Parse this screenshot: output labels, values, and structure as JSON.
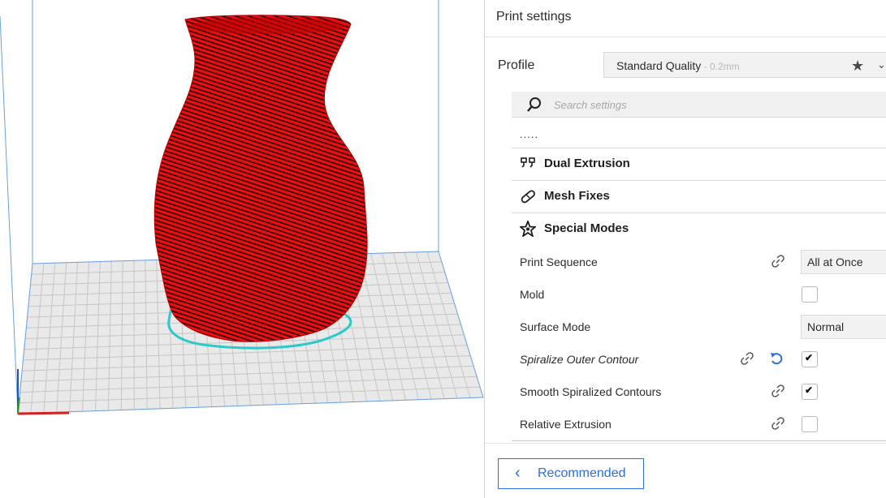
{
  "panel": {
    "title": "Print settings",
    "profile_label": "Profile",
    "profile_name": "Standard Quality",
    "profile_sub": " - 0.2mm",
    "search_placeholder": "Search settings",
    "collapsed_indicator": ".....",
    "categories": [
      {
        "label": "Dual Extrusion",
        "icon": "dual-extrusion-icon"
      },
      {
        "label": "Mesh Fixes",
        "icon": "mesh-fixes-icon"
      },
      {
        "label": "Special Modes",
        "icon": "special-modes-icon"
      }
    ],
    "settings": {
      "print_sequence": {
        "label": "Print Sequence",
        "value": "All at Once"
      },
      "mold": {
        "label": "Mold",
        "checked": false
      },
      "surface_mode": {
        "label": "Surface Mode",
        "value": "Normal"
      },
      "spiralize": {
        "label": "Spiralize Outer Contour",
        "checked": true
      },
      "smooth_spiralized": {
        "label": "Smooth Spiralized Contours",
        "checked": true
      },
      "relative_extrusion": {
        "label": "Relative Extrusion",
        "checked": false
      }
    },
    "recommended_button": "Recommended"
  },
  "colors": {
    "model": "#e81010",
    "outline": "#2dc8c8",
    "accent": "#2c6fe0"
  }
}
